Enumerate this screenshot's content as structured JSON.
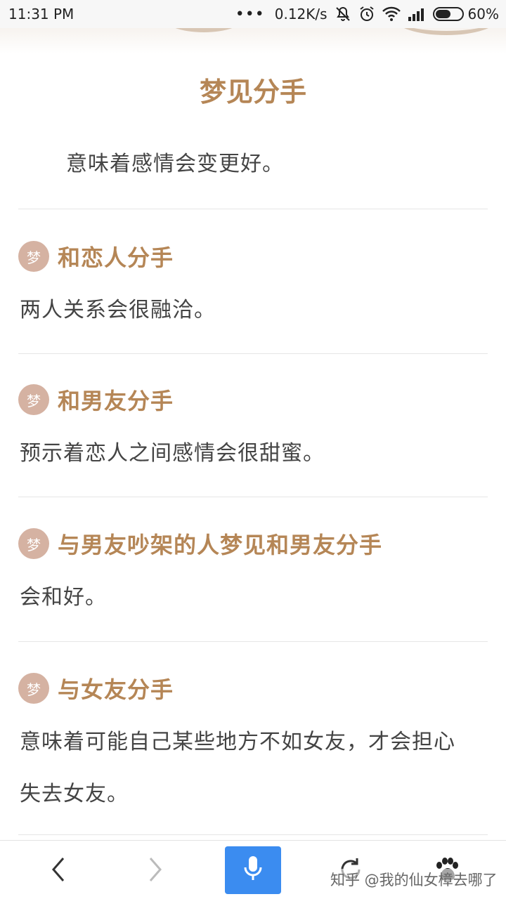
{
  "status_bar": {
    "time": "11:31 PM",
    "dots": "•••",
    "network_speed": "0.12K/s",
    "battery_percent": "60%",
    "battery_level": 0.6,
    "icons": [
      "mute-icon",
      "alarm-icon",
      "wifi-icon",
      "signal-icon",
      "battery-icon"
    ]
  },
  "article": {
    "title": "梦见分手",
    "intro": "意味着感情会变更好。",
    "badge_text": "梦",
    "sections": [
      {
        "title": "和恋人分手",
        "body": "两人关系会很融洽。"
      },
      {
        "title": "和男友分手",
        "body": "预示着恋人之间感情会很甜蜜。"
      },
      {
        "title": "与男友吵架的人梦见和男友分手",
        "body": "会和好。"
      },
      {
        "title": "与女友分手",
        "body": "意味着可能自己某些地方不如女友，才会担心失去女友。"
      }
    ]
  },
  "bottom_bar": {
    "buttons": [
      "back-icon",
      "forward-icon",
      "mic-icon",
      "refresh-icon",
      "paw-icon"
    ],
    "accent_color": "#3b8cf0"
  },
  "watermark": "知乎 @我的仙女樟去哪了",
  "colors": {
    "title": "#b58656",
    "badge": "#d5b2a2",
    "text": "#444444"
  }
}
